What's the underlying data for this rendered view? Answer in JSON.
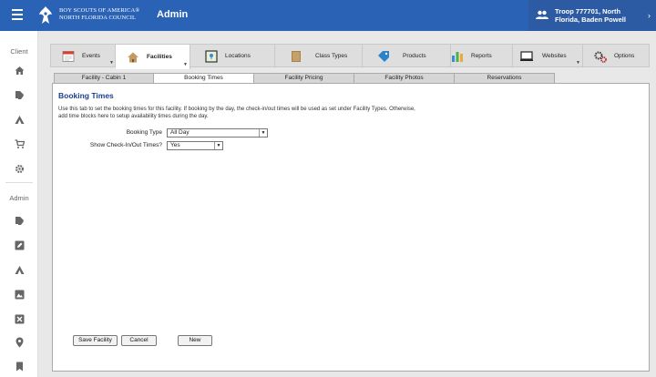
{
  "header": {
    "org_line1": "BOY SCOUTS OF AMERICA®",
    "org_line2": "NORTH FLORIDA COUNCIL",
    "title": "Admin",
    "troop_line1": "Troop 777701, North",
    "troop_line2": "Florida, Baden Powell"
  },
  "sidebar": {
    "client_label": "Client",
    "admin_label": "Admin"
  },
  "top_tabs": [
    {
      "label": "Events"
    },
    {
      "label": "Facilities"
    },
    {
      "label": "Locations"
    },
    {
      "label": "Class Types"
    },
    {
      "label": "Products"
    },
    {
      "label": "Reports"
    },
    {
      "label": "Websites"
    },
    {
      "label": "Options"
    }
  ],
  "sub_tabs": [
    {
      "label": "Facility - Cabin 1"
    },
    {
      "label": "Booking Times"
    },
    {
      "label": "Facility Pricing"
    },
    {
      "label": "Facility Photos"
    },
    {
      "label": "Reservations"
    }
  ],
  "panel": {
    "title": "Booking Times",
    "description": "Use this tab to set the booking times for this facility. If booking by the day, the check-in/out times will be used as set under Facility Types. Otherwise, add time blocks here to setup availability times during the day.",
    "booking_type_label": "Booking Type",
    "booking_type_value": "All Day",
    "checkin_label": "Show Check-In/Out Times?",
    "checkin_value": "Yes"
  },
  "buttons": {
    "save": "Save Facility",
    "cancel": "Cancel",
    "new": "New"
  },
  "colors": {
    "header_bg": "#2a62b5",
    "title_blue": "#1c3f8a"
  }
}
